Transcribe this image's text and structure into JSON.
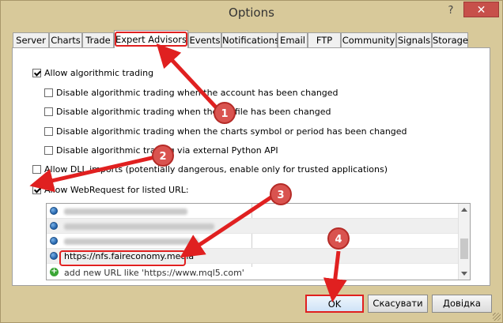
{
  "window": {
    "title": "Options",
    "help": "?",
    "close": "✕"
  },
  "tabs": [
    "Server",
    "Charts",
    "Trade",
    "Expert Advisors",
    "Events",
    "Notifications",
    "Email",
    "FTP",
    "Community",
    "Signals",
    "Storage"
  ],
  "active_tab": "Expert Advisors",
  "options": {
    "allow_algo": {
      "label": "Allow algorithmic trading",
      "checked": true
    },
    "disable_account": {
      "label": "Disable algorithmic trading when the account has been changed",
      "checked": false
    },
    "disable_profile": {
      "label": "Disable algorithmic trading when the profile has been changed",
      "checked": false
    },
    "disable_chart": {
      "label": "Disable algorithmic trading when the charts symbol or period has been changed",
      "checked": false
    },
    "disable_python": {
      "label": "Disable algorithmic trading via external Python API",
      "checked": false
    },
    "allow_dll": {
      "label": "Allow DLL imports (potentially dangerous, enable only for trusted applications)",
      "checked": false
    },
    "allow_webrequest": {
      "label": "Allow WebRequest for listed URL:",
      "checked": true
    }
  },
  "url_list": {
    "entries": [
      "",
      "",
      "",
      "https://nfs.faireconomy.media"
    ],
    "add_hint": "add new URL like 'https://www.mql5.com'"
  },
  "buttons": {
    "ok": "OK",
    "cancel": "Скасувати",
    "help": "Довідка"
  },
  "annotations": [
    "1",
    "2",
    "3",
    "4"
  ],
  "colors": {
    "annotation_red": "#e02020",
    "window_frame": "#d8c99a",
    "close_red": "#c7504a"
  }
}
